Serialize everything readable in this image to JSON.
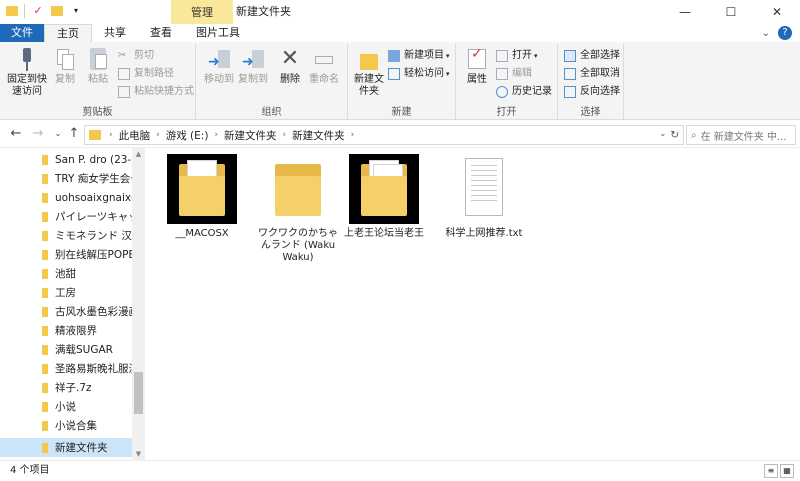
{
  "window": {
    "title": "新建文件夹",
    "context_tab": "管理",
    "minimize": "—",
    "maximize": "☐",
    "close": "✕"
  },
  "tabs": [
    "文件",
    "主页",
    "共享",
    "查看",
    "图片工具"
  ],
  "ribbon": {
    "clipboard": {
      "group": "剪贴板",
      "pin": "固定到快速访问",
      "copy": "复制",
      "paste": "粘贴",
      "cut": "剪切",
      "copy_path": "复制路径",
      "paste_shortcut": "粘贴快捷方式"
    },
    "organize": {
      "group": "组织",
      "move_to": "移动到",
      "copy_to": "复制到",
      "delete": "删除",
      "rename": "重命名"
    },
    "new": {
      "group": "新建",
      "new_folder": "新建文件夹",
      "new_item": "新建项目",
      "easy_access": "轻松访问"
    },
    "open": {
      "group": "打开",
      "properties": "属性",
      "open": "打开",
      "edit": "编辑",
      "history": "历史记录"
    },
    "select": {
      "group": "选择",
      "select_all": "全部选择",
      "select_none": "全部取消",
      "invert": "反向选择"
    }
  },
  "address": {
    "crumbs": [
      "此电脑",
      "游戏 (E:)",
      "新建文件夹",
      "新建文件夹"
    ],
    "search_placeholder": "在 新建文件夹 中..."
  },
  "sidebar": {
    "items": [
      {
        "label": "San P. dro  (23-1"
      },
      {
        "label": "TRY 痴女学生会长"
      },
      {
        "label": "uohsoaixgnaixgn"
      },
      {
        "label": "パイレーツキャッ"
      },
      {
        "label": "ミモネランド 汉化"
      },
      {
        "label": "别在线解压POPER"
      },
      {
        "label": "池甜"
      },
      {
        "label": "工房"
      },
      {
        "label": "古风水墨色彩漫画"
      },
      {
        "label": "精液限界"
      },
      {
        "label": "满载SUGAR"
      },
      {
        "label": "圣路易斯晚礼服漫"
      },
      {
        "label": "祥子.7z"
      },
      {
        "label": "小说"
      },
      {
        "label": "小说合集"
      },
      {
        "label": "新建文件夹",
        "selected": true
      }
    ]
  },
  "files": [
    {
      "name": "__MACOSX"
    },
    {
      "name": "ワクワクのかちゃんランド (Waku Waku)"
    },
    {
      "name": "上老王论坛当老王"
    },
    {
      "name": "科学上网推荐.txt"
    }
  ],
  "status": {
    "count": "4 个项目"
  }
}
